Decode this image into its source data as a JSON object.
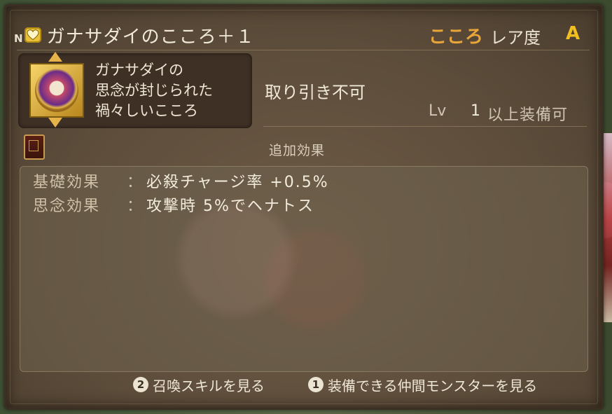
{
  "item": {
    "rank": "N",
    "icon": "heart-icon",
    "name": "ガナサダイのこころ＋１",
    "category": "こころ",
    "rarity_label": "レア度",
    "rarity_value": "A",
    "description": [
      "ガナサダイの",
      "思念が封じられた",
      "禍々しいこころ"
    ],
    "trade": "取り引き不可",
    "level_label": "Lv",
    "level_value": "1",
    "level_text": "以上装備可"
  },
  "effects": {
    "header": "追加効果",
    "rows": [
      {
        "label": "基礎効果",
        "colon": "：",
        "value": "必殺チャージ率 +0.5%"
      },
      {
        "label": "思念効果",
        "colon": "：",
        "value": "攻撃時 5%でヘナトス"
      }
    ]
  },
  "footer": {
    "buttons": [
      {
        "key": "2",
        "label": "召喚スキルを見る"
      },
      {
        "key": "1",
        "label": "装備できる仲間モンスターを見る"
      }
    ]
  },
  "colors": {
    "accent_gold": "#f0c020",
    "category_orange": "#e8a53a",
    "heart_yellow": "#e9c23a"
  }
}
